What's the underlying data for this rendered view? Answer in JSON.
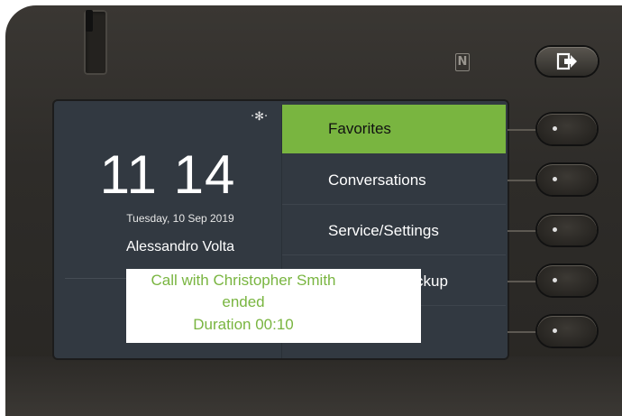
{
  "device": {
    "nfc_label": "N"
  },
  "status": {
    "bluetooth_icon": "bluetooth-icon",
    "time": "11 14",
    "date": "Tuesday, 10 Sep 2019",
    "owner": "Alessandro Volta"
  },
  "menu": {
    "items": [
      {
        "label": "Favorites",
        "active": true
      },
      {
        "label": "Conversations",
        "active": false
      },
      {
        "label": "Service/Settings",
        "active": false
      },
      {
        "label": "Pickup",
        "visible_fragment": "ckup",
        "active": false
      },
      {
        "label": "",
        "active": false
      }
    ]
  },
  "toast": {
    "line1": "Call with Christopher Smith",
    "line2": "ended",
    "line3": "Duration 00:10"
  },
  "colors": {
    "accent": "#79b540",
    "screen_bg": "#323941",
    "housing": "#2e2c29"
  }
}
